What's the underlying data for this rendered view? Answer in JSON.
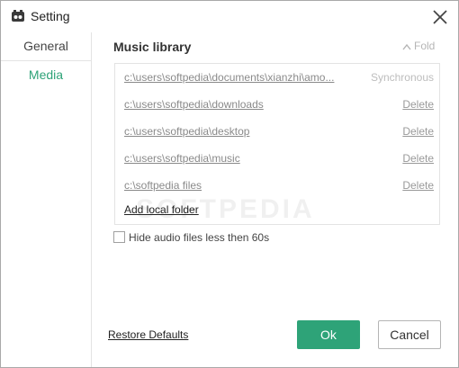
{
  "window": {
    "title": "Setting",
    "icons": {
      "app": "music-app-icon",
      "close": "close-icon"
    }
  },
  "sidebar": {
    "items": [
      {
        "label": "General",
        "selected": false
      },
      {
        "label": "Media",
        "selected": true
      }
    ]
  },
  "music_library": {
    "title": "Music library",
    "fold_label": "Fold",
    "fold_icon": "chevron-up-icon",
    "folders": [
      {
        "path": "c:\\users\\softpedia\\documents\\xianzhi\\amo...",
        "action": "Synchronous"
      },
      {
        "path": "c:\\users\\softpedia\\downloads",
        "action": "Delete"
      },
      {
        "path": "c:\\users\\softpedia\\desktop",
        "action": "Delete"
      },
      {
        "path": "c:\\users\\softpedia\\music",
        "action": "Delete"
      },
      {
        "path": "c:\\softpedia files",
        "action": "Delete"
      }
    ],
    "add_folder_label": "Add local folder"
  },
  "options": {
    "hide_short_audio": {
      "label": "Hide audio files less then 60s",
      "checked": false
    }
  },
  "footer": {
    "restore_label": "Restore Defaults",
    "ok_label": "Ok",
    "cancel_label": "Cancel"
  },
  "watermark": "SOFTPEDIA",
  "colors": {
    "accent": "#2ea378",
    "border": "#e3e3e3",
    "muted_text": "#8a8a8a"
  }
}
